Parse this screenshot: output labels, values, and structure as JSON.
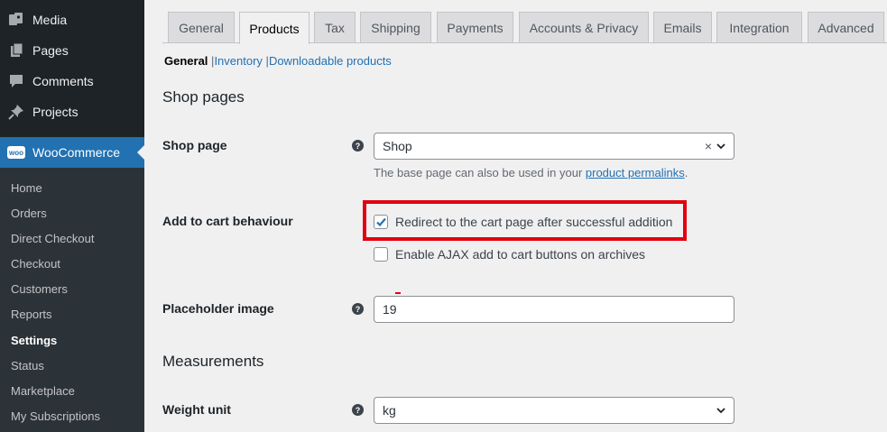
{
  "sidebar": {
    "top_items": [
      {
        "label": "Media",
        "icon": "media-icon"
      },
      {
        "label": "Pages",
        "icon": "pages-icon"
      },
      {
        "label": "Comments",
        "icon": "comments-icon"
      },
      {
        "label": "Projects",
        "icon": "pin-icon"
      }
    ],
    "woocommerce": {
      "label": "WooCommerce",
      "badge": "woo"
    },
    "submenu": [
      "Home",
      "Orders",
      "Direct Checkout",
      "Checkout",
      "Customers",
      "Reports",
      "Settings",
      "Status",
      "Marketplace",
      "My Subscriptions"
    ],
    "current_submenu": "Settings"
  },
  "tabs": [
    "General",
    "Products",
    "Tax",
    "Shipping",
    "Payments",
    "Accounts & Privacy",
    "Emails",
    "Integration",
    "Advanced"
  ],
  "active_tab": "Products",
  "subnav": {
    "current": "General",
    "links": [
      "Inventory",
      "Downloadable products"
    ],
    "separator": "|"
  },
  "shop_pages": {
    "heading": "Shop pages",
    "shop_page": {
      "label": "Shop page",
      "value": "Shop",
      "clear": "×",
      "desc_prefix": "The base page can also be used in your ",
      "desc_link": "product permalinks",
      "desc_suffix": "."
    },
    "add_to_cart": {
      "label": "Add to cart behaviour",
      "option1": {
        "label": "Redirect to the cart page after successful addition",
        "checked": true
      },
      "option2": {
        "label": "Enable AJAX add to cart buttons on archives",
        "checked": false
      }
    },
    "placeholder_image": {
      "label": "Placeholder image",
      "value": "19"
    }
  },
  "measurements": {
    "heading": "Measurements",
    "weight_unit": {
      "label": "Weight unit",
      "value": "kg"
    }
  },
  "help_glyph": "?",
  "colors": {
    "accent": "#2271b1",
    "sidebar": "#1d2327",
    "highlight": "#e3000f"
  }
}
